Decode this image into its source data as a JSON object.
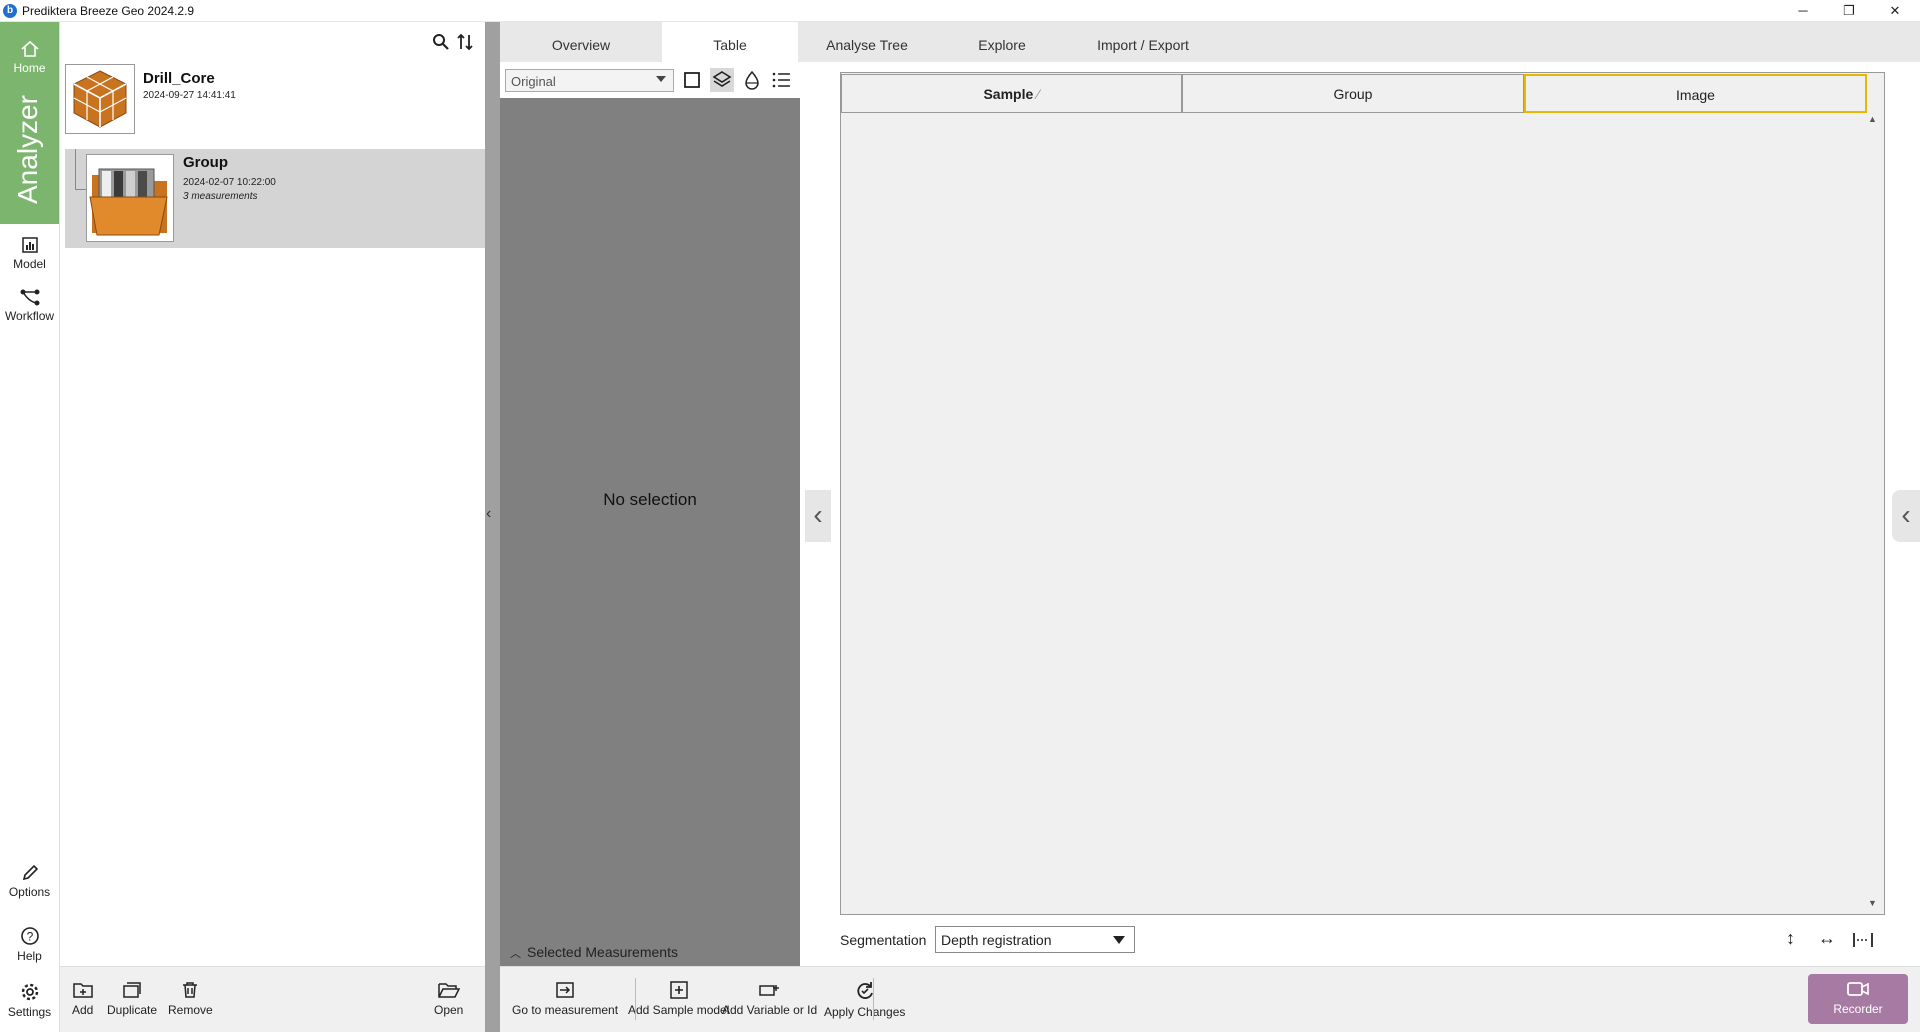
{
  "window": {
    "title": "Prediktera Breeze Geo 2024.2.9",
    "icon_letter": "b",
    "minimize": "─",
    "restore": "❐",
    "close": "✕"
  },
  "rail": {
    "home": "Home",
    "analyzer": "Analyzer",
    "model": "Model",
    "workflow": "Workflow",
    "options": "Options",
    "help": "Help",
    "settings": "Settings"
  },
  "projects": [
    {
      "title": "Drill_Core",
      "date": "2024-09-27 14:41:41",
      "subtitle": ""
    },
    {
      "title": "Group",
      "date": "2024-02-07 10:22:00",
      "subtitle": "3 measurements"
    }
  ],
  "left_toolbar": {
    "add": "Add",
    "duplicate": "Duplicate",
    "remove": "Remove",
    "open": "Open"
  },
  "tabs": [
    "Overview",
    "Table",
    "Analyse Tree",
    "Explore",
    "Import / Export"
  ],
  "active_tab": "Table",
  "middle": {
    "select_value": "Original",
    "no_selection": "No selection",
    "selected_measurements": "Selected Measurements"
  },
  "table": {
    "columns": [
      "Sample",
      "Group",
      "Image"
    ],
    "sort_indicator": "⁄"
  },
  "segmentation": {
    "label": "Segmentation",
    "value": "Depth registration"
  },
  "bottom_toolbar": {
    "go_to_measurement": "Go to measurement",
    "add_sample_model": "Add Sample model",
    "add_variable": "Add Variable or Id",
    "apply_changes": "Apply Changes"
  },
  "recorder": "Recorder",
  "colors": {
    "accent_green": "#7cb66e",
    "recorder_purple": "#a77aa3",
    "highlight_yellow": "#e6b800",
    "box_orange": "#c8731f"
  }
}
